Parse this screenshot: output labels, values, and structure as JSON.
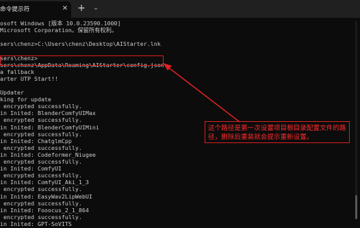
{
  "window": {
    "tab_title": "命令提示符",
    "close_glyph": "✕",
    "new_tab_glyph": "+",
    "dropdown_glyph": "⌄"
  },
  "terminal": {
    "lines": [
      "osoft Windows [版本 10.0.23590.1000]",
      "Microsoft Corporation。保留所有权利。",
      "",
      "sers\\chenz>C:\\Users\\chenz\\Desktop\\AIStarter.lnk",
      "",
      "sers\\chenz>",
      "sers\\chenz\\AppData\\Roaming\\AIStarter\\config.json",
      "a fallback",
      "arter UTP Start!!",
      "",
      "Updater",
      "king for update",
      " encrypted successfully.",
      "in Inited: BlenderComfyUIMax",
      " encrypted successfully.",
      "in Inited: BlenderComfyUIMini",
      " encrypted successfully.",
      "in Inited: ChatglmCpp",
      " encrypted successfully.",
      "in Inited: Codeformer_Niugee",
      " encrypted successfully.",
      "in Inited: ComfyUI",
      " encrypted successfully.",
      "in Inited: ComfyUI_Aki_1_3",
      " encrypted successfully.",
      "in Inited: EasyWav2LipWebUI",
      " encrypted successfully.",
      "in Inited: Fooocus_2_1_864",
      " encrypted successfully.",
      "in Inited: GPT-SoVITS"
    ]
  },
  "annotation": {
    "text": "这个路径是第一次设置项目根目录配置文件的路径，删除后重装就会提示重新设置。",
    "color": "#e02020"
  },
  "theme": {
    "background": "#0c0c0c",
    "titlebar": "#202020",
    "text": "#cccccc"
  }
}
